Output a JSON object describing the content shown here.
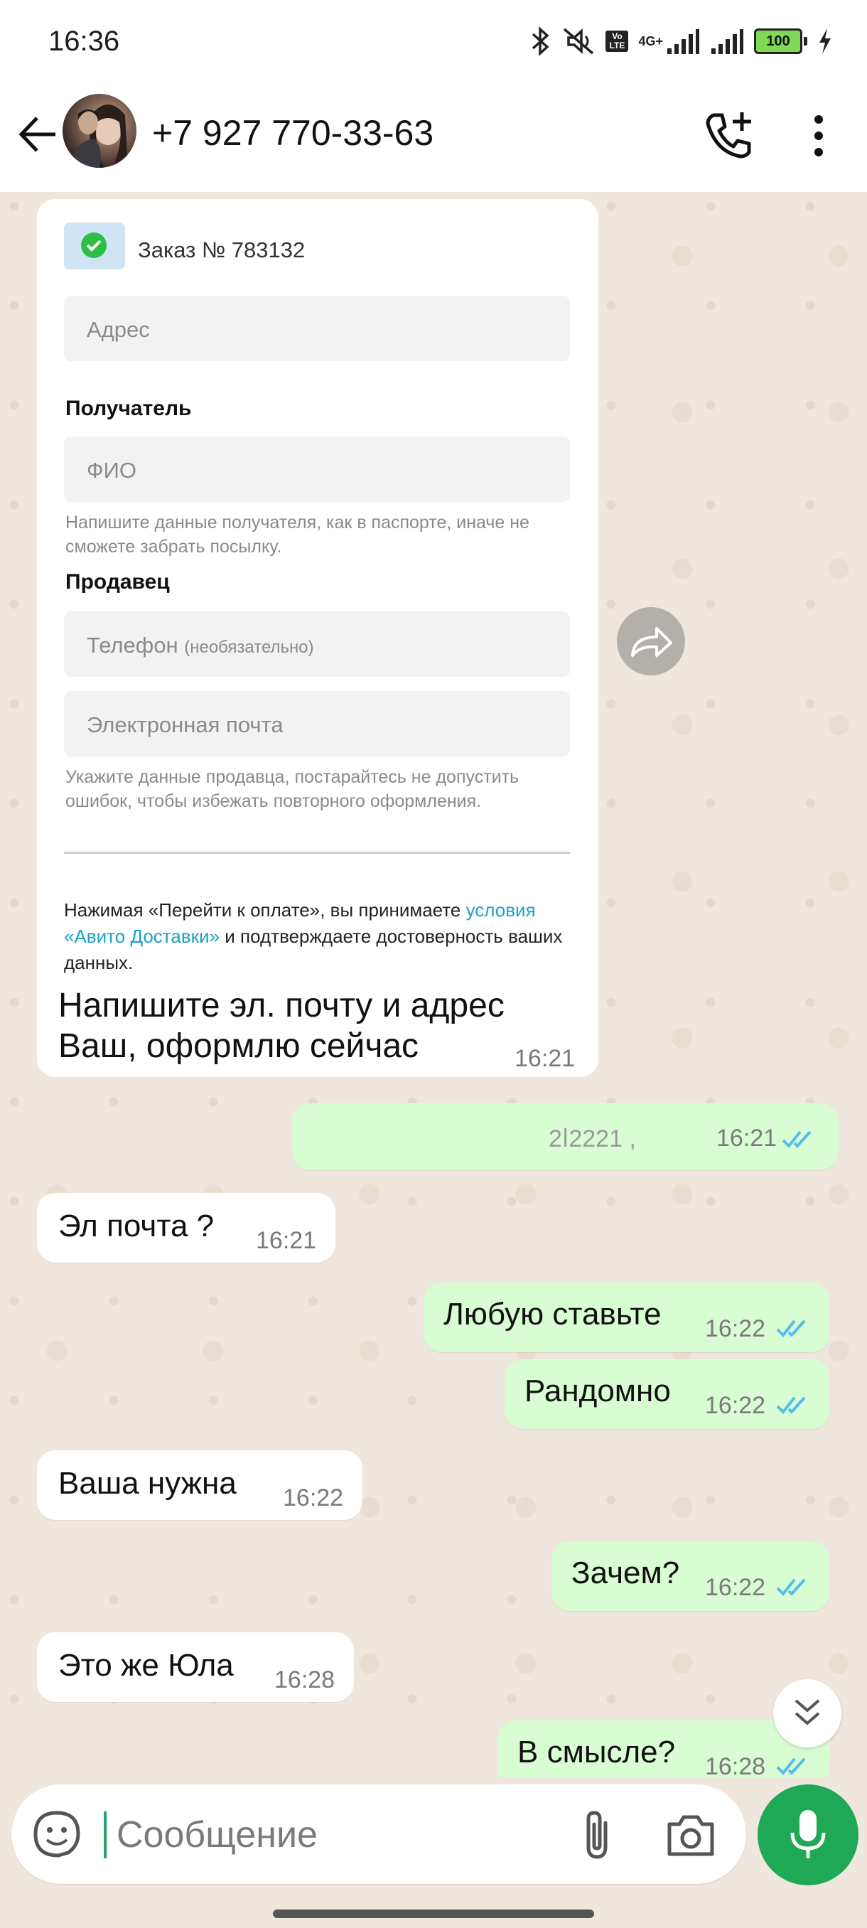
{
  "status_bar": {
    "time": "16:36",
    "network": "4G+",
    "volte": "Vo LTE",
    "battery": "100"
  },
  "header": {
    "contact_name": "+7 927 770-33-63"
  },
  "screenshot_card": {
    "order_title": "Заказ № 783132",
    "address_placeholder": "Адрес",
    "recipient_heading": "Получатель",
    "name_placeholder": "ФИО",
    "recipient_hint": "Напишите данные получателя, как в паспорте, иначе не сможете забрать посылку.",
    "seller_heading": "Продавец",
    "phone_placeholder": "Телефон",
    "phone_optional": "(необязательно)",
    "email_placeholder": "Электронная почта",
    "seller_hint": "Укажите данные продавца, постарайтесь не допустить ошибок, чтобы избежать повторного оформления.",
    "legal_text_1": "Нажимая «Перейти к оплате», вы принимаете ",
    "legal_link": "условия «Авито Доставки»",
    "legal_text_2": " и подтверждаете достоверность ваших данных.",
    "caption": "Напишите эл. почту и адрес Ваш, оформлю сейчас",
    "time": "16:21"
  },
  "messages": [
    {
      "direction": "out",
      "text": "2ⅼ2221 ,",
      "time": "16:21",
      "read": true
    },
    {
      "direction": "in",
      "text": "Эл почта ?",
      "time": "16:21"
    },
    {
      "direction": "out",
      "text": "Любую ставьте",
      "time": "16:22",
      "read": true
    },
    {
      "direction": "out",
      "text": "Рандомно",
      "time": "16:22",
      "read": true
    },
    {
      "direction": "in",
      "text": "Ваша нужна",
      "time": "16:22"
    },
    {
      "direction": "out",
      "text": "Зачем?",
      "time": "16:22",
      "read": true
    },
    {
      "direction": "in",
      "text": "Это же Юла",
      "time": "16:28"
    },
    {
      "direction": "out",
      "text": "В смысле?",
      "time": "16:28",
      "read": true
    }
  ],
  "composer": {
    "placeholder": "Сообщение"
  },
  "colors": {
    "outgoing_bubble": "#d9fdd3",
    "incoming_bubble": "#ffffff",
    "chat_background": "#efe7dd",
    "accent_green": "#1fa855",
    "read_ticks": "#53bdeb",
    "link": "#19a3c7"
  },
  "icons": [
    "bluetooth-icon",
    "mute-icon",
    "signal-icon",
    "battery-icon",
    "charging-icon",
    "back-icon",
    "add-call-icon",
    "more-options-icon",
    "forward-icon",
    "scroll-down-icon",
    "emoji-icon",
    "attach-icon",
    "camera-icon",
    "mic-icon",
    "read-ticks-icon"
  ]
}
